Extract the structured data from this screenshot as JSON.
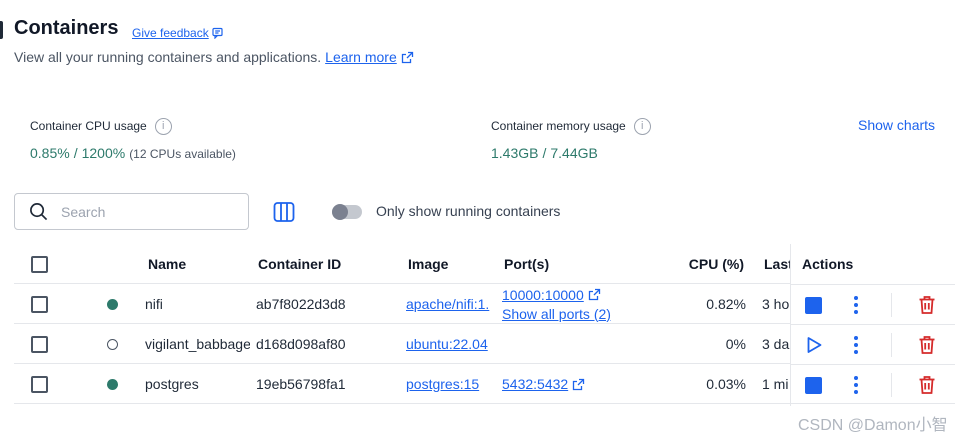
{
  "page": {
    "title": "Containers",
    "feedback_label": "Give feedback",
    "subtitle": "View all your running containers and applications.",
    "learn_more_label": "Learn more"
  },
  "stats": {
    "cpu": {
      "label": "Container CPU usage",
      "used": "0.85%",
      "sep": "/",
      "total": "1200%",
      "note": "(12 CPUs available)"
    },
    "memory": {
      "label": "Container memory usage",
      "used": "1.43GB",
      "sep": "/",
      "total": "7.44GB"
    },
    "show_charts_label": "Show charts"
  },
  "toolbar": {
    "search_placeholder": "Search",
    "toggle_label": "Only show running containers",
    "toggle_on": false
  },
  "table": {
    "headers": {
      "name": "Name",
      "container_id": "Container ID",
      "image": "Image",
      "ports": "Port(s)",
      "cpu": "CPU (%)",
      "last": "Last",
      "actions": "Actions"
    },
    "rows": [
      {
        "status": "running",
        "name": "nifi",
        "container_id": "ab7f8022d3d8",
        "image": "apache/nifi:1.",
        "port_main": "10000:10000",
        "port_more": "Show all ports (2)",
        "cpu": "0.82%",
        "last": "3 ho"
      },
      {
        "status": "stopped",
        "name": "vigilant_babbage",
        "container_id": "d168d098af80",
        "image": "ubuntu:22.04",
        "port_main": "",
        "port_more": "",
        "cpu": "0%",
        "last": "3 da"
      },
      {
        "status": "running",
        "name": "postgres",
        "container_id": "19eb56798fa1",
        "image": "postgres:15",
        "port_main": "5432:5432",
        "port_more": "",
        "cpu": "0.03%",
        "last": "1 mi"
      }
    ]
  },
  "colors": {
    "accent": "#1d63ed",
    "running": "#2d7a6b",
    "delete": "#d52b2b"
  },
  "watermark": "CSDN @Damon小智"
}
